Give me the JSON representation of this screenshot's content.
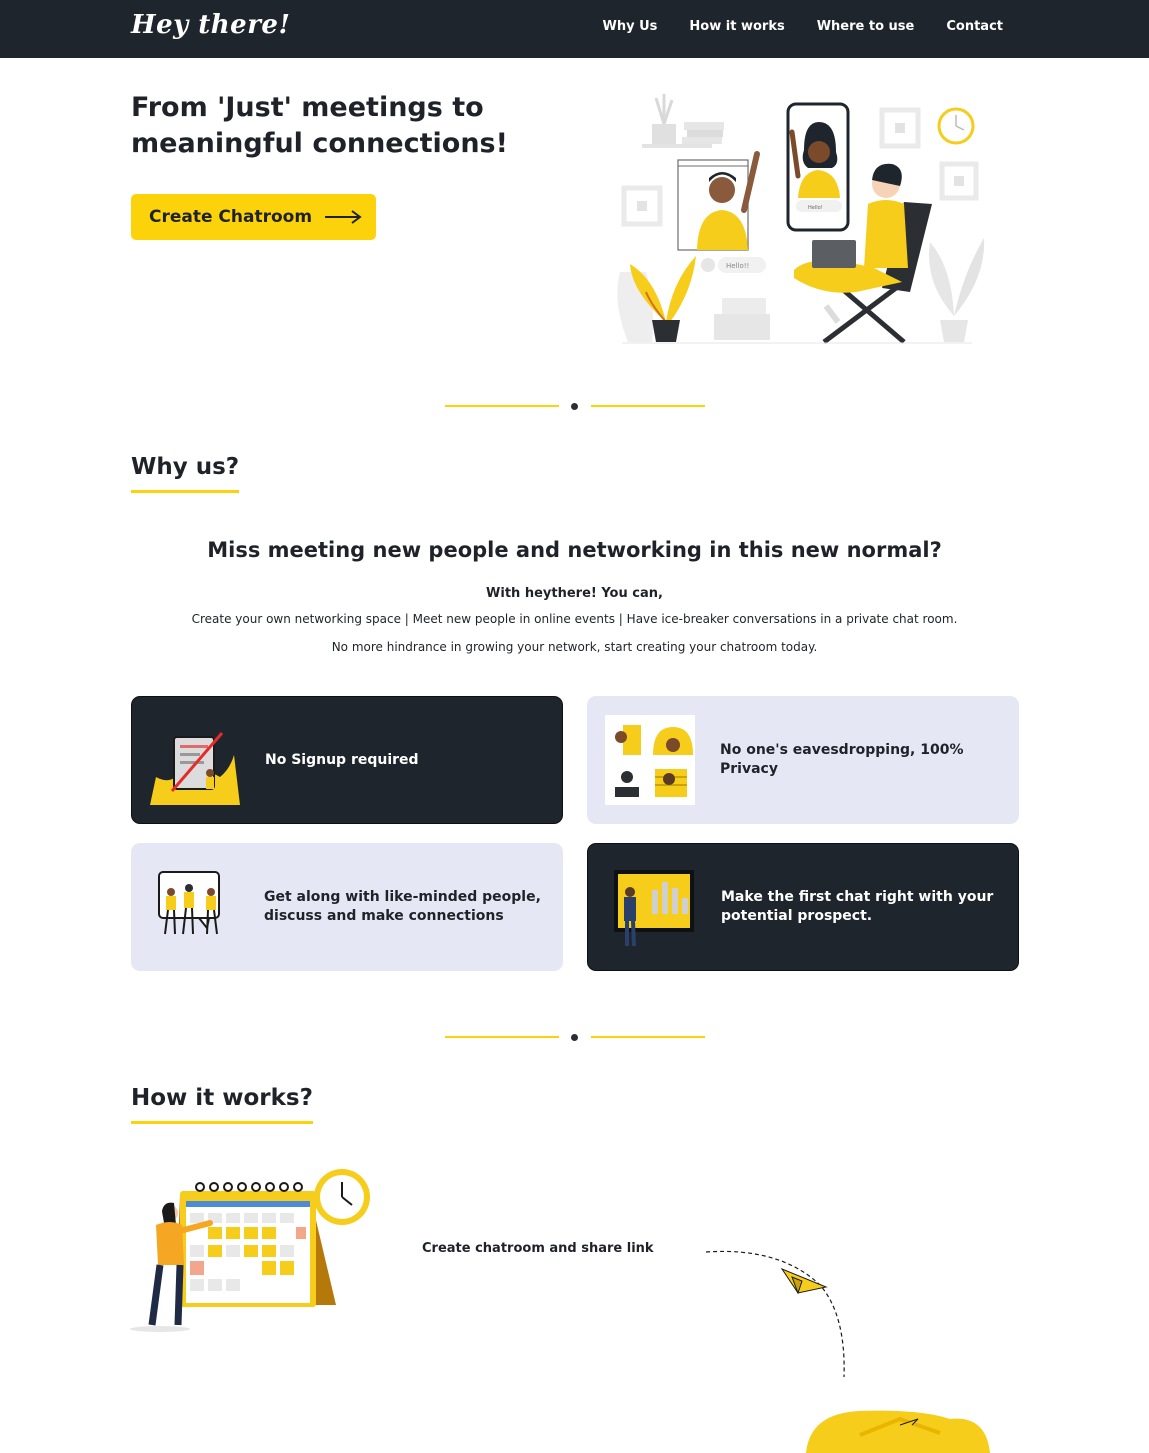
{
  "nav": {
    "logo": "Hey there!",
    "links": [
      "Why Us",
      "How it works",
      "Where to use",
      "Contact"
    ]
  },
  "hero": {
    "title": "From 'Just' meetings to meaningful connections!",
    "cta_label": "Create Chatroom",
    "phone_bubble": "Hello!",
    "chat_bubble": "Hello!!"
  },
  "why": {
    "heading": "Why us?",
    "subtitle": "Miss meeting new people and networking in this new normal?",
    "intro": "With heythere! You can,",
    "features_line": "Create your own networking space | Meet new people in online events | Have ice-breaker conversations in a private chat room.",
    "closing_line": "No more hindrance in growing your network, start creating your chatroom today.",
    "cards": [
      {
        "text": "No Signup required",
        "icon": "no-signup-illustration"
      },
      {
        "text": "No one's eavesdropping, 100% Privacy",
        "icon": "privacy-illustration"
      },
      {
        "text": "Get along with like-minded people, discuss and make connections",
        "icon": "discussion-illustration"
      },
      {
        "text": "Make the first chat right with your potential prospect.",
        "icon": "presentation-illustration"
      }
    ]
  },
  "how": {
    "heading": "How it works?",
    "step1": "Create chatroom and share link"
  },
  "colors": {
    "accent": "#fcd20b",
    "dark": "#1f252c",
    "light_card": "#e6e7f4"
  }
}
